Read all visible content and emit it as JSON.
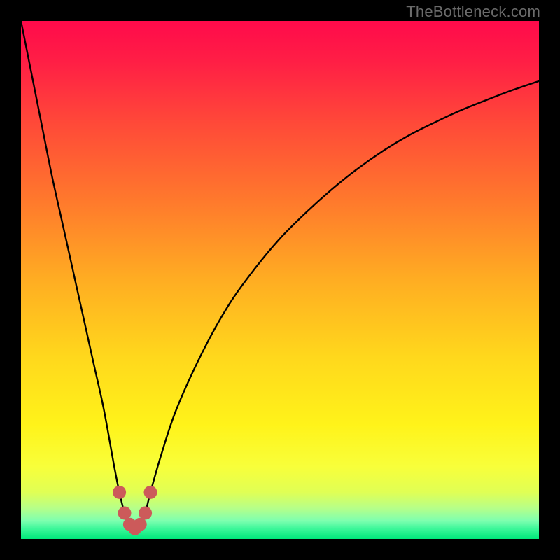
{
  "watermark": {
    "text": "TheBottleneck.com"
  },
  "chart_data": {
    "type": "line",
    "title": "",
    "xlabel": "",
    "ylabel": "",
    "xlim": [
      0,
      100
    ],
    "ylim": [
      0,
      100
    ],
    "x": [
      0,
      2,
      4,
      6,
      8,
      10,
      12,
      14,
      16,
      18,
      19,
      20,
      21,
      22,
      23,
      24,
      25,
      27,
      30,
      35,
      40,
      45,
      50,
      55,
      60,
      65,
      70,
      75,
      80,
      85,
      90,
      95,
      100
    ],
    "y": [
      100,
      90,
      80,
      70,
      61,
      52,
      43,
      34,
      25,
      14,
      9,
      5,
      2.5,
      2,
      2.5,
      5,
      9,
      16,
      25,
      36,
      45,
      52,
      58,
      63,
      67.5,
      71.5,
      75,
      78,
      80.5,
      82.8,
      84.8,
      86.7,
      88.4
    ],
    "minimum_x": 22,
    "minimum_y": 2,
    "marker_points": [
      {
        "x": 19.0,
        "y": 9
      },
      {
        "x": 20.0,
        "y": 5
      },
      {
        "x": 21.0,
        "y": 2.8
      },
      {
        "x": 22.0,
        "y": 2.0
      },
      {
        "x": 23.0,
        "y": 2.8
      },
      {
        "x": 24.0,
        "y": 5
      },
      {
        "x": 25.0,
        "y": 9
      }
    ],
    "gradient_stops": [
      {
        "pos": 0.0,
        "color": "#ff0a4b"
      },
      {
        "pos": 0.08,
        "color": "#ff1f45"
      },
      {
        "pos": 0.2,
        "color": "#ff4a38"
      },
      {
        "pos": 0.35,
        "color": "#ff7a2c"
      },
      {
        "pos": 0.5,
        "color": "#ffad22"
      },
      {
        "pos": 0.65,
        "color": "#ffd81c"
      },
      {
        "pos": 0.78,
        "color": "#fff31a"
      },
      {
        "pos": 0.86,
        "color": "#f8ff3a"
      },
      {
        "pos": 0.92,
        "color": "#d4ff70"
      },
      {
        "pos": 0.955,
        "color": "#a3ffa0"
      },
      {
        "pos": 0.975,
        "color": "#5cf f bd"
      },
      {
        "pos": 1.0,
        "color": "#00e87a"
      }
    ]
  }
}
